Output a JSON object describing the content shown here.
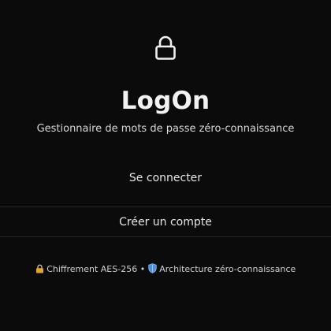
{
  "app": {
    "title": "LogOn",
    "subtitle": "Gestionnaire de mots de passe zéro-connaissance"
  },
  "actions": {
    "login_label": "Se connecter",
    "register_label": "Créer un compte"
  },
  "footer": {
    "encryption_label": "Chiffrement AES-256",
    "separator": "•",
    "architecture_label": "Architecture zéro-connaissance",
    "encryption_icon": "lock-icon",
    "architecture_icon": "shield-icon"
  },
  "header": {
    "icon": "lock-icon"
  },
  "colors": {
    "background": "#0b0b0b",
    "text": "#ececec",
    "divider": "#262626",
    "lock_gold": "#e0a52a",
    "shield_blue": "#4a8fe0"
  }
}
